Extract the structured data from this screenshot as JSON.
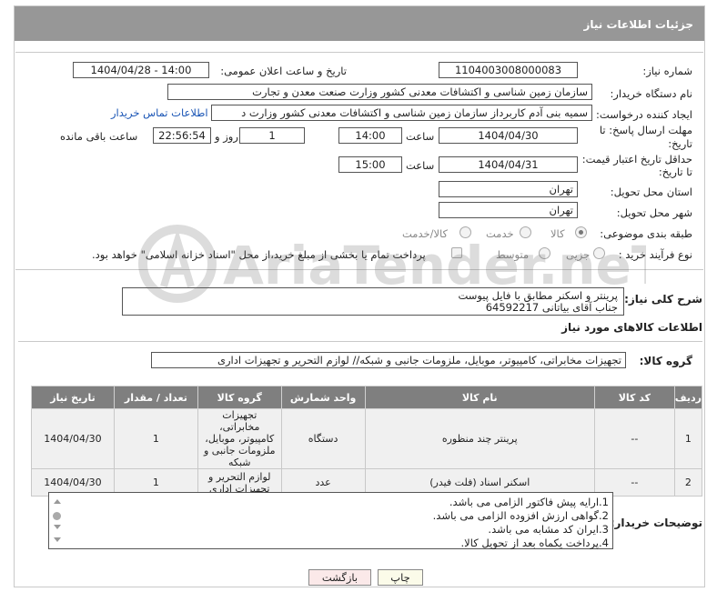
{
  "header": {
    "title": "جزئیات اطلاعات نیاز"
  },
  "form": {
    "need_number_label": "شماره نیاز:",
    "need_number": "1104003008000083",
    "announce_label": "تاریخ و ساعت اعلان عمومی:",
    "announce_value": "1404/04/28 - 14:00",
    "buyer_org_label": "نام دستگاه خریدار:",
    "buyer_org": "سازمان زمین شناسی و اکتشافات معدنی کشور وزارت صنعت معدن و تجارت",
    "creator_label": "ایجاد کننده درخواست:",
    "creator": "سمیه بنی آدم کاربرداز سازمان زمین شناسی و اکتشافات معدنی کشور وزارت د",
    "contact_link": "اطلاعات تماس خریدار",
    "reply_deadline_label_1": "مهلت ارسال پاسخ: تا",
    "reply_deadline_label_2": "تاریخ:",
    "reply_date": "1404/04/30",
    "time_label": "ساعت",
    "reply_time": "14:00",
    "days_value": "1",
    "days_label": "روز و",
    "remaining_value": "22:56:54",
    "remaining_label": "ساعت باقی مانده",
    "price_validity_label_1": "حداقل تاریخ اعتبار قیمت:",
    "price_validity_label_2": "تا تاریخ:",
    "price_date": "1404/04/31",
    "price_time": "15:00",
    "province_label": "استان محل تحویل:",
    "province": "تهران",
    "city_label": "شهر محل تحویل:",
    "city": "تهران",
    "category_label": "طبقه بندی موضوعی:",
    "category_options": [
      "کالا",
      "خدمت",
      "کالا/خدمت"
    ],
    "category_selected": "کالا",
    "process_label": "نوع فرآیند خرید :",
    "process_options": [
      "جزیی",
      "متوسط"
    ],
    "payment_note": "پرداخت تمام یا بخشی از مبلغ خرید،از محل \"اسناد خزانه اسلامی\" خواهد بود."
  },
  "description": {
    "label": "شرح کلی نیاز:",
    "lines": [
      "پرینتر و اسکنر مطابق با فایل پیوست",
      "جناب آقای بیاتانی 64592217"
    ]
  },
  "goods_section": {
    "title": "اطلاعات کالاهای مورد نیاز",
    "group_label": "گروه کالا:",
    "group_value": "تجهیزات مخابراتی، کامپیوتر، موبایل، ملزومات جانبی و شبکه// لوازم التحریر و تجهیزات اداری"
  },
  "table": {
    "headers": [
      "ردیف",
      "کد کالا",
      "نام کالا",
      "واحد شمارش",
      "گروه کالا",
      "تعداد / مقدار",
      "تاریخ نیاز"
    ],
    "rows": [
      {
        "row": "1",
        "code": "--",
        "name": "پرینتر چند منظوره",
        "unit": "دستگاه",
        "group": "تجهیزات مخابراتی، کامپیوتر، موبایل، ملزومات جانبی و شبکه",
        "qty": "1",
        "date": "1404/04/30"
      },
      {
        "row": "2",
        "code": "--",
        "name": "اسکنر اسناد (فلت فیدر)",
        "unit": "عدد",
        "group": "لوازم التحریر و تجهیزات اداری",
        "qty": "1",
        "date": "1404/04/30"
      }
    ]
  },
  "buyer_notes": {
    "label": "توضیحات خریدار:",
    "lines": [
      "1.ارایه پیش فاکتور الزامی می باشد.",
      "2.گواهی ارزش افزوده الزامی می باشد.",
      "3.ایران کد مشابه می باشد.",
      "4.پرداخت یکماه بعد از تحویل کالا."
    ]
  },
  "buttons": {
    "print": "چاپ",
    "back": "بازگشت"
  },
  "watermark": {
    "text": "AriaTender.neT"
  },
  "colors": {
    "header_bg": "#979797",
    "table_header_bg": "#7f7f7f",
    "link": "#1a55b5"
  }
}
